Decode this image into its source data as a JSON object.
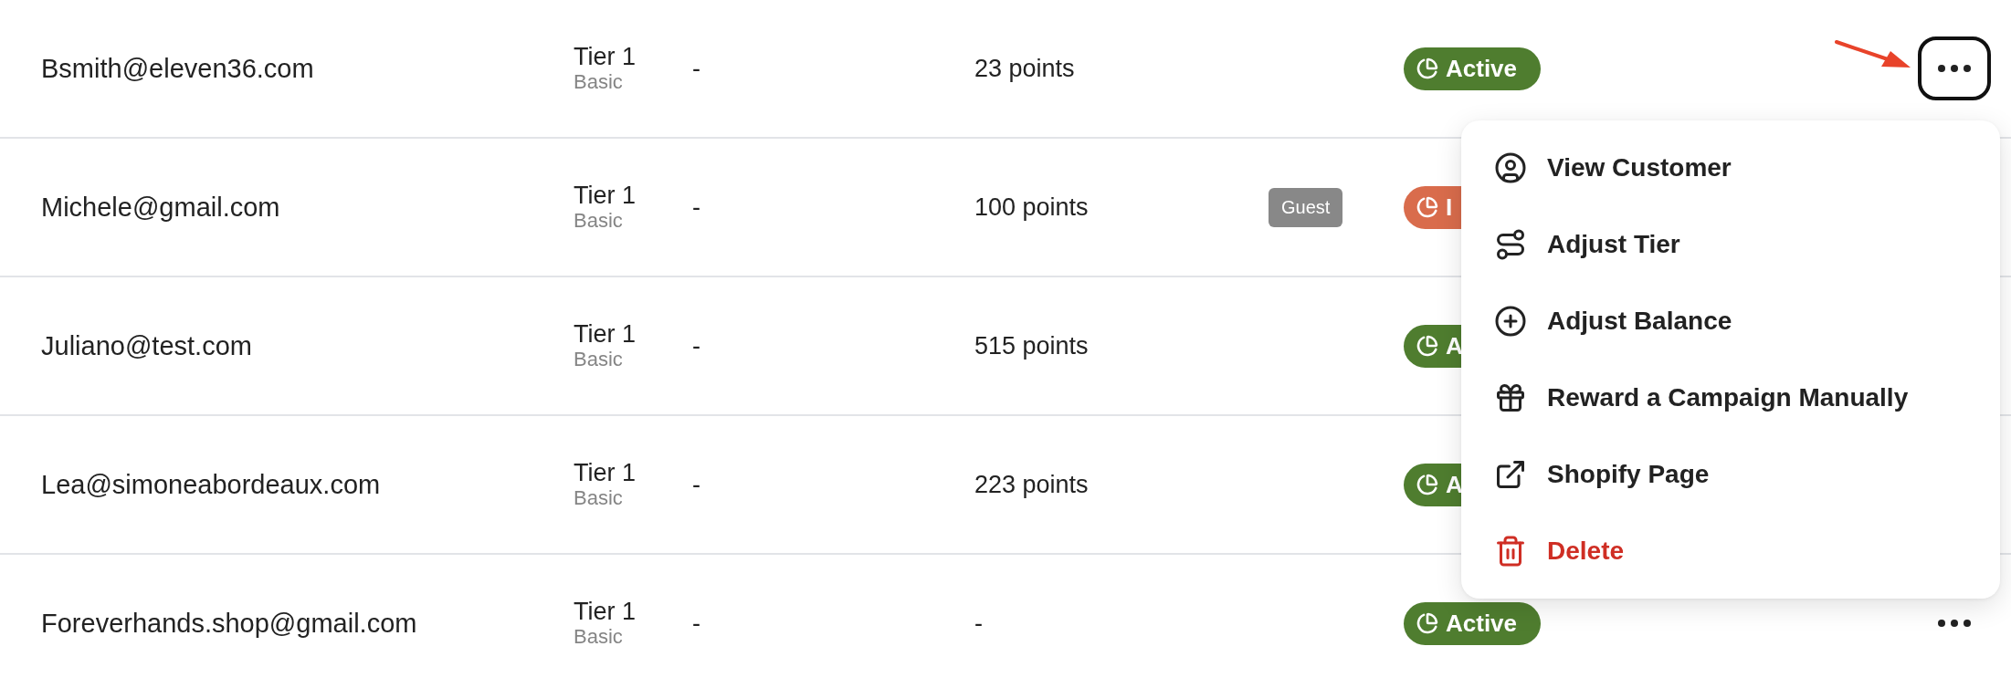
{
  "rows": [
    {
      "email": "Bsmith@eleven36.com",
      "tier": "Tier 1",
      "tier_name": "Basic",
      "column_3": "-",
      "points": "23 points",
      "status": {
        "label": "Active",
        "kind": "active"
      },
      "more_button": {
        "open": true
      }
    },
    {
      "email": "Michele@gmail.com",
      "tier": "Tier 1",
      "tier_name": "Basic",
      "column_3": "-",
      "points": "100 points",
      "tag": "Guest",
      "status": {
        "label": "I",
        "kind": "inactive"
      }
    },
    {
      "email": "Juliano@test.com",
      "tier": "Tier 1",
      "tier_name": "Basic",
      "column_3": "-",
      "points": "515 points",
      "status": {
        "label": "A",
        "kind": "active"
      }
    },
    {
      "email": "Lea@simoneabordeaux.com",
      "tier": "Tier 1",
      "tier_name": "Basic",
      "column_3": "-",
      "points": "223 points",
      "status": {
        "label": "A",
        "kind": "active"
      }
    },
    {
      "email": "Foreverhands.shop@gmail.com",
      "tier": "Tier 1",
      "tier_name": "Basic",
      "column_3": "-",
      "points": "-",
      "status": {
        "label": "Active",
        "kind": "active"
      },
      "more_button": {
        "open": false
      }
    }
  ],
  "menu": {
    "items": [
      {
        "label": "View Customer",
        "kind": "normal"
      },
      {
        "label": "Adjust Tier",
        "kind": "normal"
      },
      {
        "label": "Adjust Balance",
        "kind": "normal"
      },
      {
        "label": "Reward a Campaign Manually",
        "kind": "normal"
      },
      {
        "label": "Shopify Page",
        "kind": "normal"
      },
      {
        "label": "Delete",
        "kind": "danger"
      }
    ]
  }
}
